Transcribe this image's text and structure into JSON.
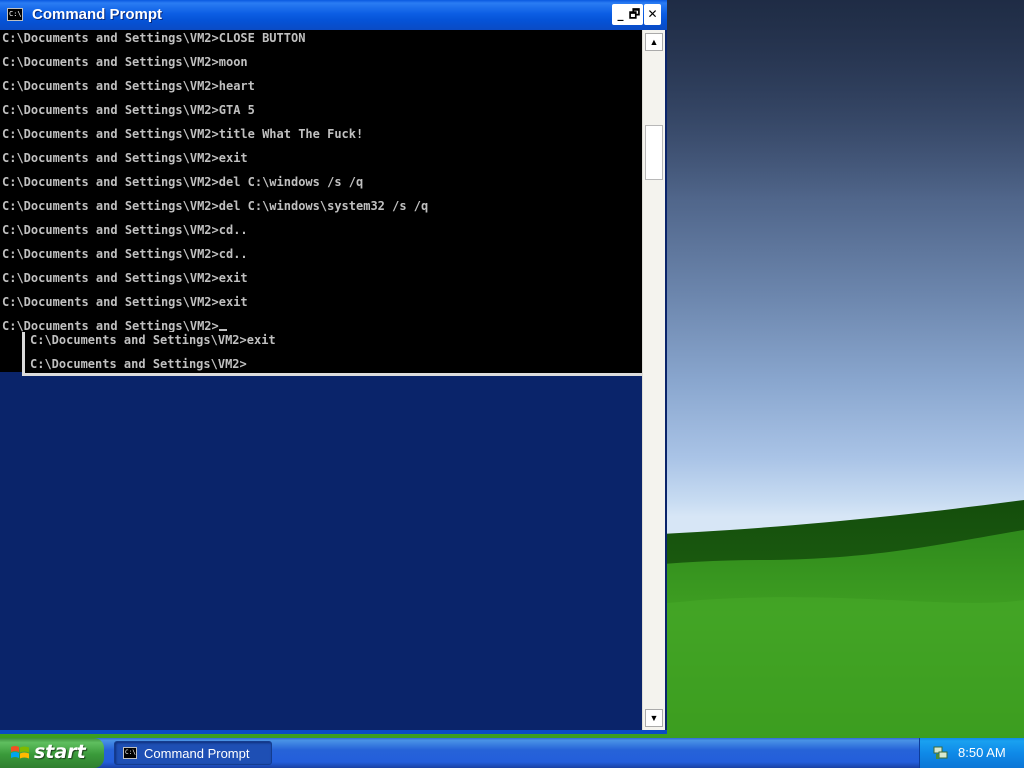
{
  "window": {
    "title": "Command Prompt",
    "buttons": {
      "minimize": "_",
      "restore": "🗗",
      "close": "✕"
    },
    "icon_text": "C:\\"
  },
  "console": {
    "lines": [
      "C:\\Documents and Settings\\VM2>CLOSE BUTTON",
      "C:\\Documents and Settings\\VM2>moon",
      "C:\\Documents and Settings\\VM2>heart",
      "C:\\Documents and Settings\\VM2>GTA 5",
      "C:\\Documents and Settings\\VM2>title What The Fuck!",
      "C:\\Documents and Settings\\VM2>exit",
      "C:\\Documents and Settings\\VM2>del C:\\windows /s /q",
      "C:\\Documents and Settings\\VM2>del C:\\windows\\system32 /s /q",
      "C:\\Documents and Settings\\VM2>cd..",
      "C:\\Documents and Settings\\VM2>cd..",
      "C:\\Documents and Settings\\VM2>exit",
      "C:\\Documents and Settings\\VM2>exit"
    ],
    "prompt": "C:\\Documents and Settings\\VM2>",
    "ghost_lines": [
      "C:\\Documents and Settings\\VM2>exit",
      "C:\\Documents and Settings\\VM2>"
    ]
  },
  "scrollbar": {
    "up": "▲",
    "down": "▼"
  },
  "taskbar": {
    "start_label": "start",
    "tasks": [
      {
        "label": "Command Prompt",
        "icon": "cmd-icon"
      }
    ],
    "clock": "8:50 AM",
    "tray_icon": "network-icon"
  },
  "colors": {
    "titlebar": "#0c5ee4",
    "console_bg": "#000000",
    "console_fg": "#c0c0c0",
    "start_green": "#3a9a3a",
    "taskbar_blue": "#245edb"
  }
}
